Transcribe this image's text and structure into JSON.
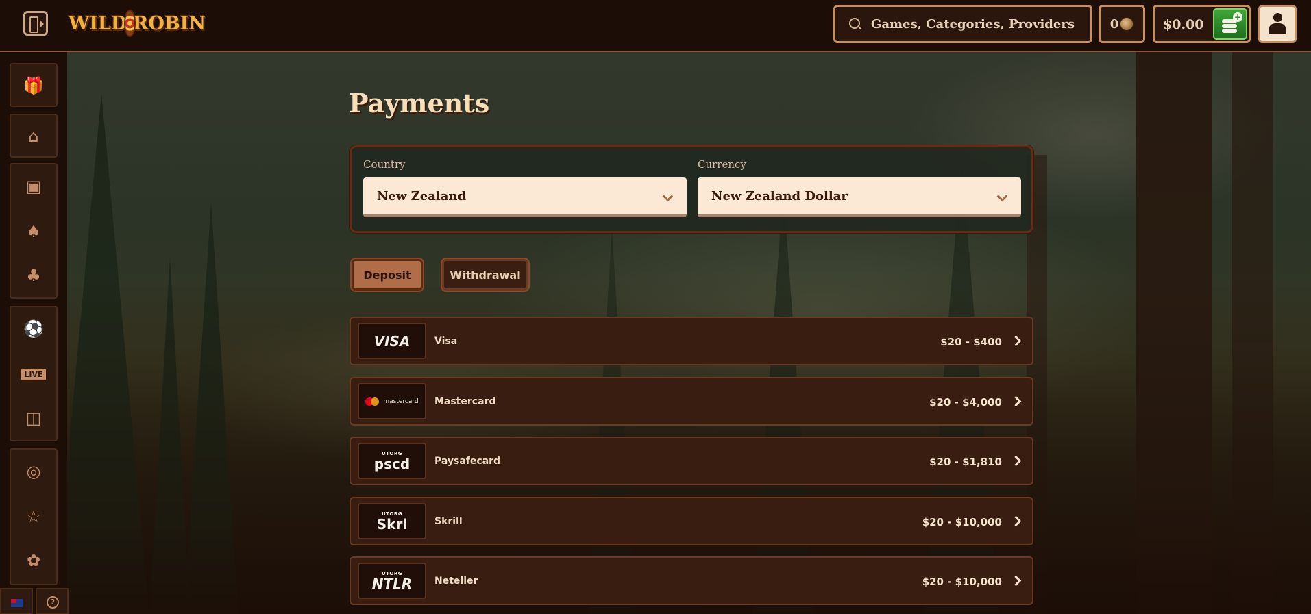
{
  "header": {
    "logo_text_left": "WILD",
    "logo_text_right": "ROBIN",
    "search_placeholder": "Games, Categories, Providers",
    "coins": "0",
    "balance": "$0.00"
  },
  "sidebar": {
    "groups": [
      {
        "items": [
          "gift-icon"
        ]
      },
      {
        "items": [
          "home-icon"
        ]
      },
      {
        "items": [
          "slot-machine-icon",
          "cards-icon",
          "clover-icon"
        ]
      },
      {
        "items": [
          "ball-icon",
          "live-icon",
          "tv-game-icon"
        ]
      },
      {
        "items": [
          "target-icon",
          "trophy-icon",
          "feather-icon"
        ]
      }
    ],
    "live_label": "LIVE"
  },
  "page": {
    "title": "Payments",
    "country_label": "Country",
    "country_value": "New Zealand",
    "currency_label": "Currency",
    "currency_value": "New Zealand Dollar",
    "tabs": [
      "Deposit",
      "Withdrawal"
    ],
    "active_tab": "Deposit"
  },
  "methods": [
    {
      "name": "Visa",
      "logo": "VISA",
      "range": "$20 - $400"
    },
    {
      "name": "Mastercard",
      "logo": "mastercard",
      "range": "$20 - $4,000"
    },
    {
      "name": "Paysafecard",
      "logo": "pscd",
      "logo_sub": "UTORG",
      "range": "$20 - $1,810"
    },
    {
      "name": "Skrill",
      "logo": "Skrl",
      "logo_sub": "UTORG",
      "range": "$20 - $10,000"
    },
    {
      "name": "Neteller",
      "logo": "NTLR",
      "logo_sub": "UTORG",
      "range": "$20 - $10,000"
    }
  ],
  "colors": {
    "background": "#1c0e07",
    "accent": "#c68f5c",
    "deposit_green": "#3fa83a",
    "row_bg": "#3a1d11"
  }
}
